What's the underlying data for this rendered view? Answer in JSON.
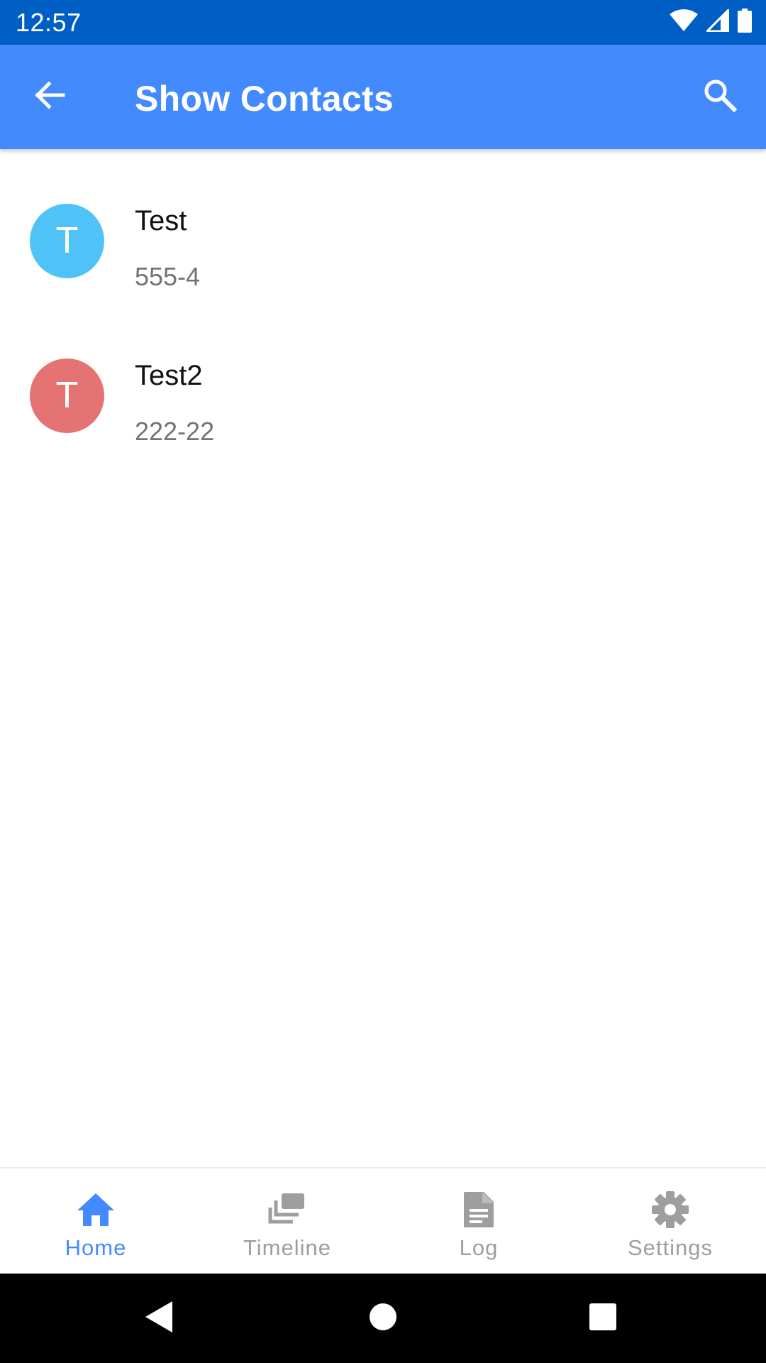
{
  "status_bar": {
    "time": "12:57",
    "icons": [
      "wifi-icon",
      "cell-signal-icon",
      "battery-icon"
    ],
    "background": "#005FC4"
  },
  "app_bar": {
    "title": "Show Contacts",
    "background": "#448AFF",
    "back_icon": "arrow-back-icon",
    "search_icon": "search-icon"
  },
  "contacts": [
    {
      "initial": "T",
      "name": "Test",
      "phone": "555-4",
      "avatar_color": "#4FC3F7"
    },
    {
      "initial": "T",
      "name": "Test2",
      "phone": "222-22",
      "avatar_color": "#E57373"
    }
  ],
  "bottom_nav": {
    "active_color": "#448AFF",
    "inactive_color": "#9E9E9E",
    "items": [
      {
        "label": "Home",
        "icon": "home-icon",
        "active": true
      },
      {
        "label": "Timeline",
        "icon": "timeline-icon",
        "active": false
      },
      {
        "label": "Log",
        "icon": "document-icon",
        "active": false
      },
      {
        "label": "Settings",
        "icon": "gear-icon",
        "active": false
      }
    ]
  },
  "system_nav": {
    "buttons": [
      "back-triangle-icon",
      "home-circle-icon",
      "recents-square-icon"
    ]
  }
}
